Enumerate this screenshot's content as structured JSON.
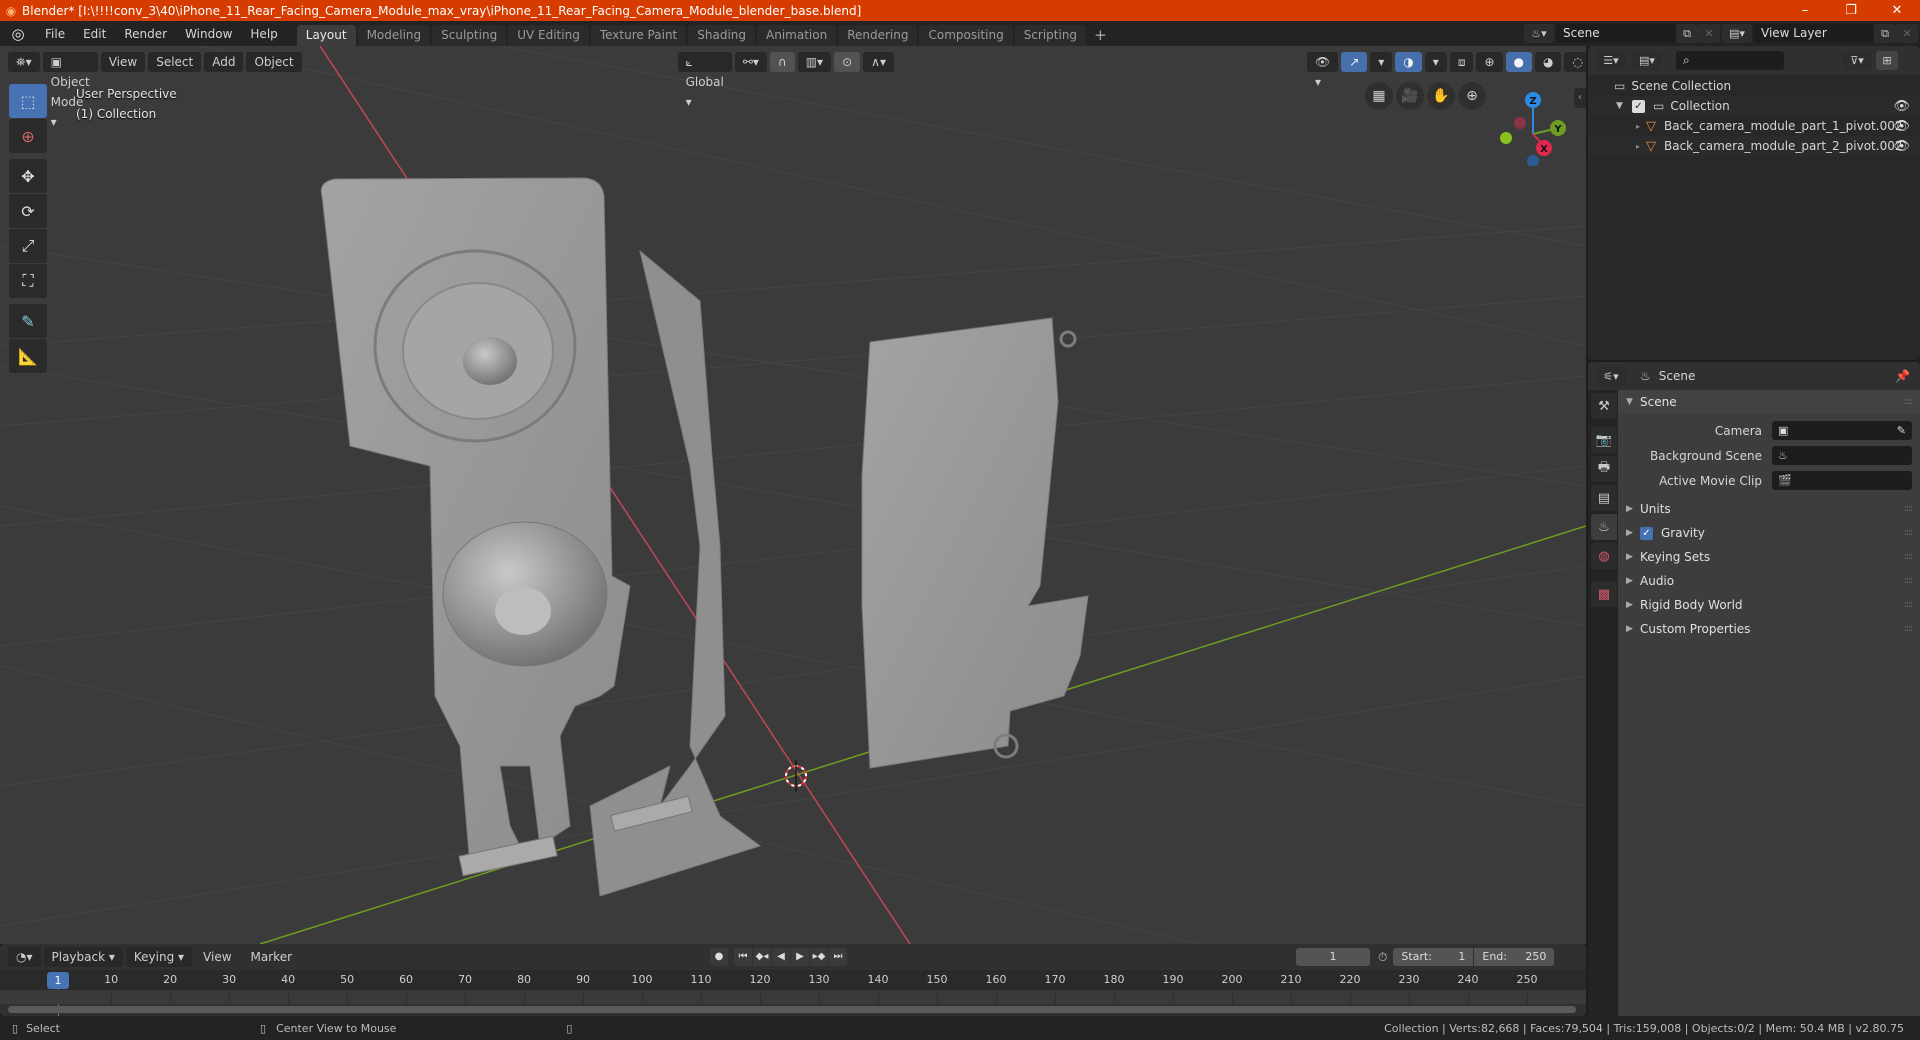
{
  "titlebar": {
    "title": "Blender* [I:\\!!!!conv_3\\40\\iPhone_11_Rear_Facing_Camera_Module_max_vray\\iPhone_11_Rear_Facing_Camera_Module_blender_base.blend]",
    "minimize": "–",
    "maximize": "❐",
    "close": "✕"
  },
  "menubar": {
    "items": [
      "File",
      "Edit",
      "Render",
      "Window",
      "Help"
    ]
  },
  "workspaces": {
    "tabs": [
      "Layout",
      "Modeling",
      "Sculpting",
      "UV Editing",
      "Texture Paint",
      "Shading",
      "Animation",
      "Rendering",
      "Compositing",
      "Scripting"
    ],
    "active": "Layout",
    "add": "+"
  },
  "scene_selector": {
    "value": "Scene"
  },
  "viewlayer_selector": {
    "value": "View Layer"
  },
  "viewport": {
    "mode": "Object Mode",
    "menus": [
      "View",
      "Select",
      "Add",
      "Object"
    ],
    "orientation": "Global",
    "perspective_label": "User Perspective",
    "collection_label": "(1) Collection",
    "gizmo_axes": {
      "x": "X",
      "y": "Y",
      "z": "Z"
    },
    "colors": {
      "x_axis": "#c4455a",
      "y_axis": "#6f9c22",
      "z_axis": "#2b8ae6",
      "grid_bg": "#3b3b3b",
      "mesh": "#9a9a9a"
    }
  },
  "outliner": {
    "search_placeholder": "",
    "root": "Scene Collection",
    "collection": "Collection",
    "objects": [
      "Back_camera_module_part_1_pivot.002",
      "Back_camera_module_part_2_pivot.002"
    ]
  },
  "properties": {
    "context": "Scene",
    "panel_title": "Scene",
    "fields": [
      {
        "label": "Camera",
        "value": ""
      },
      {
        "label": "Background Scene",
        "value": ""
      },
      {
        "label": "Active Movie Clip",
        "value": ""
      }
    ],
    "sections": [
      {
        "label": "Units",
        "checkbox": false
      },
      {
        "label": "Gravity",
        "checkbox": true
      },
      {
        "label": "Keying Sets",
        "checkbox": false
      },
      {
        "label": "Audio",
        "checkbox": false
      },
      {
        "label": "Rigid Body World",
        "checkbox": false
      },
      {
        "label": "Custom Properties",
        "checkbox": false
      }
    ]
  },
  "timeline": {
    "menus": [
      "Playback",
      "Keying",
      "View",
      "Marker"
    ],
    "current_frame": "1",
    "start_label": "Start:",
    "start": "1",
    "end_label": "End:",
    "end": "250",
    "ticks": [
      "10",
      "20",
      "30",
      "40",
      "50",
      "60",
      "70",
      "80",
      "90",
      "100",
      "110",
      "120",
      "130",
      "140",
      "150",
      "160",
      "170",
      "180",
      "190",
      "200",
      "210",
      "220",
      "230",
      "240",
      "250"
    ],
    "playhead_label": "1"
  },
  "statusbar": {
    "left_action": "Select",
    "middle_action": "Center View to Mouse",
    "stats": "Collection | Verts:82,668 | Faces:79,504 | Tris:159,008 | Objects:0/2 | Mem: 50.4 MB | v2.80.75"
  },
  "theme": {
    "accent": "#4772b3",
    "titlebar": "#d63c00",
    "object_icon": "#e08d3c"
  }
}
